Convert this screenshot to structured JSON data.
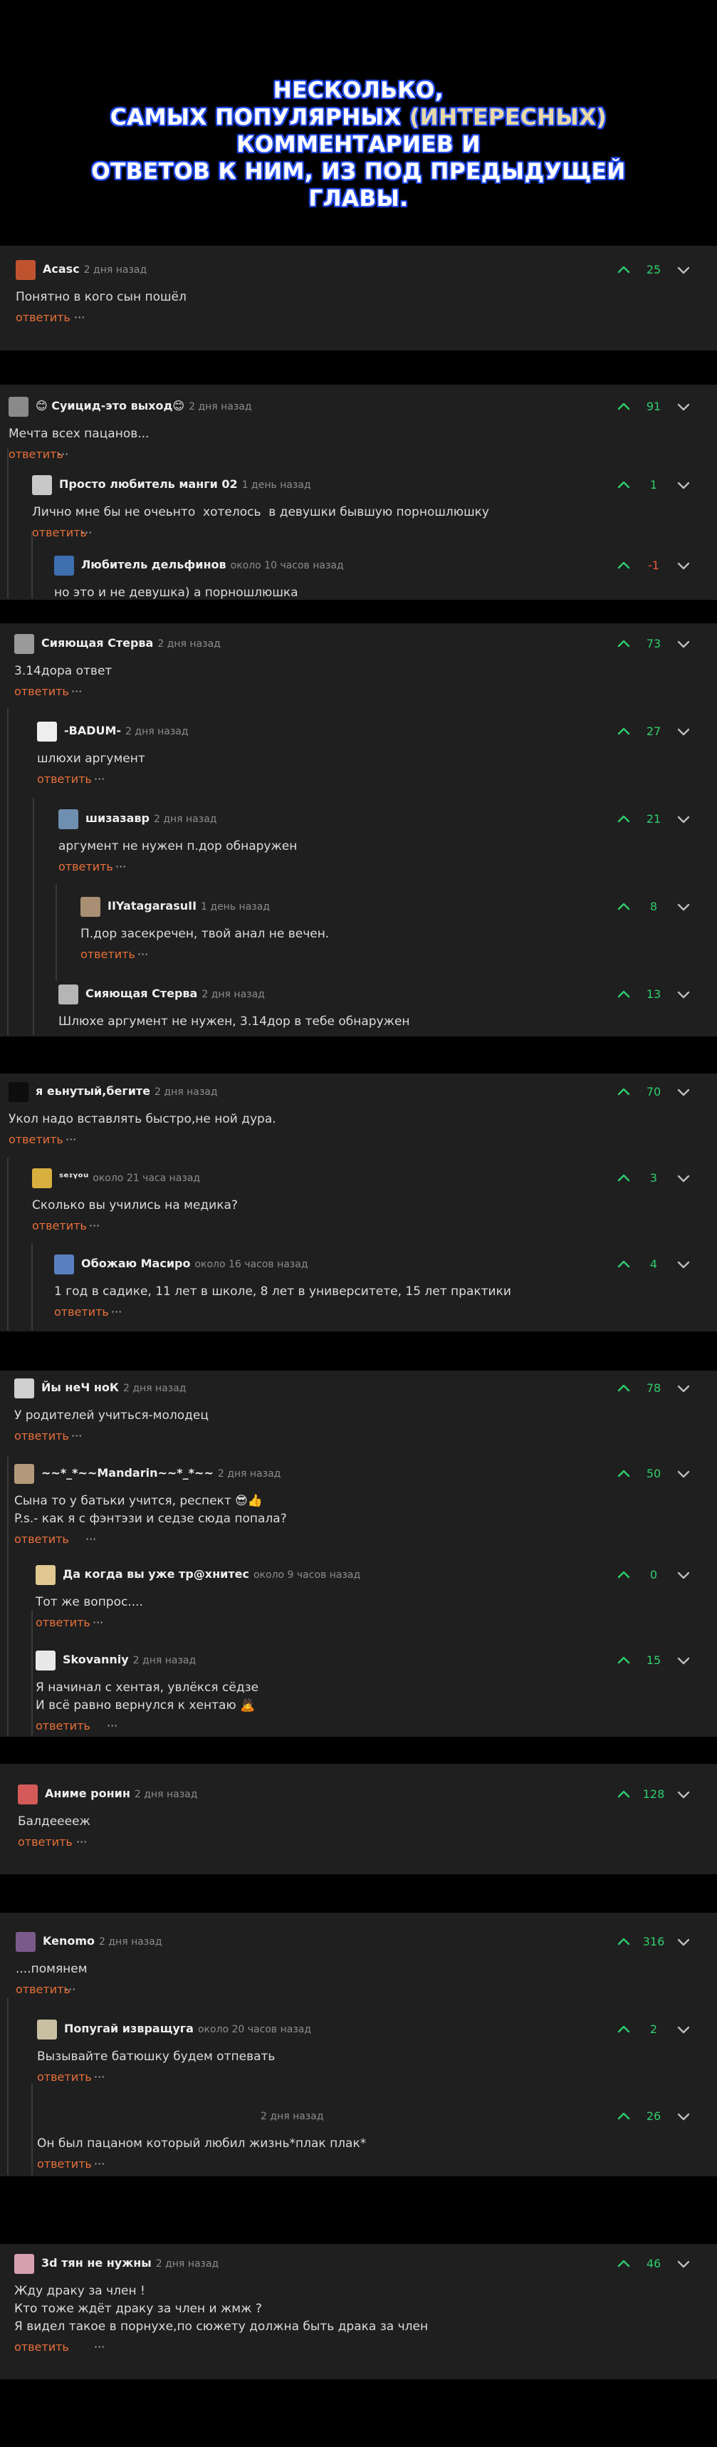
{
  "header": {
    "line1": "Несколько,",
    "line2a": "самых популярных ",
    "line2b": "(интересных)",
    "line2c": " комментариев и",
    "line3": "ответов к ним, из под предыдущей",
    "line4": "главы."
  },
  "ui": {
    "reply": "ответить",
    "more": "···"
  },
  "colors": {
    "score_positive": "#2fce6d",
    "score_negative": "#e85a3a",
    "reply": "#e8703a",
    "panel": "#1f1f1f"
  },
  "comments": [
    {
      "author": "Acasc",
      "time": "2 дня назад",
      "score": "25",
      "text": "Понятно в кого сын пошёл"
    },
    {
      "author": "😊 Суицид-это выход😊",
      "time": "2 дня назад",
      "score": "91",
      "text": "Мечта всех пацанов..."
    },
    {
      "author": "Просто любитель манги 02",
      "time": "1 день назад",
      "score": "1",
      "text": "Лично мне бы не очеьнто  хотелось  в девушки бывшую порношлюшку"
    },
    {
      "author": "Любитель дельфинов",
      "time": "около 10 часов назад",
      "score": "-1",
      "text": "но это и не девушка) а порношлюшка"
    },
    {
      "author": "Сияющая Стерва",
      "time": "2 дня назад",
      "score": "73",
      "text": "3.14дора ответ"
    },
    {
      "author": "-BADUM-",
      "time": "2 дня назад",
      "score": "27",
      "text": "шлюхи аргумент"
    },
    {
      "author": "шизазавр",
      "time": "2 дня назад",
      "score": "21",
      "text": "аргумент не нужен п.дор обнаружен"
    },
    {
      "author": "IIYatagarasuII",
      "time": "1 день назад",
      "score": "8",
      "text": "П.дор засекречен, твой анал не вечен."
    },
    {
      "author": "Сияющая Стерва",
      "time": "2 дня назад",
      "score": "13",
      "text": "Шлюхе аргумент не нужен, 3.14дор в тебе обнаружен"
    },
    {
      "author": "я еьнутый,бегите",
      "time": "2 дня назад",
      "score": "70",
      "text": "Укол надо вставлять быстро,не ной дура."
    },
    {
      "author": "ˢᵉᶦᵞᵒᵘ",
      "time": "около 21 часа назад",
      "score": "3",
      "text": "Сколько вы учились на медика?"
    },
    {
      "author": "Обожаю Масиро",
      "time": "около 16 часов назад",
      "score": "4",
      "text": "1 год в садике, 11 лет в школе, 8 лет в университете, 15 лет практики"
    },
    {
      "author": "Йы неЧ ноК",
      "time": "2 дня назад",
      "score": "78",
      "text": "У родителей учиться-молодец"
    },
    {
      "author": "~~*_*~~Mandarin~~*_*~~",
      "time": "2 дня назад",
      "score": "50",
      "text": "Сына то у батьки учится, респект 😎👍\nP.s.- как я с фэнтэзи и седзе сюда попала?"
    },
    {
      "author": "Да когда вы уже тр@хнитес",
      "time": "около 9 часов назад",
      "score": "0",
      "text": "Тот же вопрос...."
    },
    {
      "author": "Skovanniy",
      "time": "2 дня назад",
      "score": "15",
      "text": "Я начинал с хентая, увлёкся сёдзе\nИ всё равно вернулся к хентаю 🙇"
    },
    {
      "author": "Аниме ронин",
      "time": "2 дня назад",
      "score": "128",
      "text": "Балдееееж"
    },
    {
      "author": "Kenomo",
      "time": "2 дня назад",
      "score": "316",
      "text": "....помянем"
    },
    {
      "author": "Попугай извращуга",
      "time": "около 20 часов назад",
      "score": "2",
      "text": "Вызывайте батюшку будем отпевать"
    },
    {
      "author": "",
      "time": "2 дня назад",
      "score": "26",
      "text": "Он был пацаном который любил жизнь*плак плак*"
    },
    {
      "author": "3d тян не нужны",
      "time": "2 дня назад",
      "score": "46",
      "text": "Жду драку за член !\nКто тоже ждёт драку за член и жмж ?\nЯ видел такое в порнухе,по сюжету должна быть драка за член"
    }
  ]
}
